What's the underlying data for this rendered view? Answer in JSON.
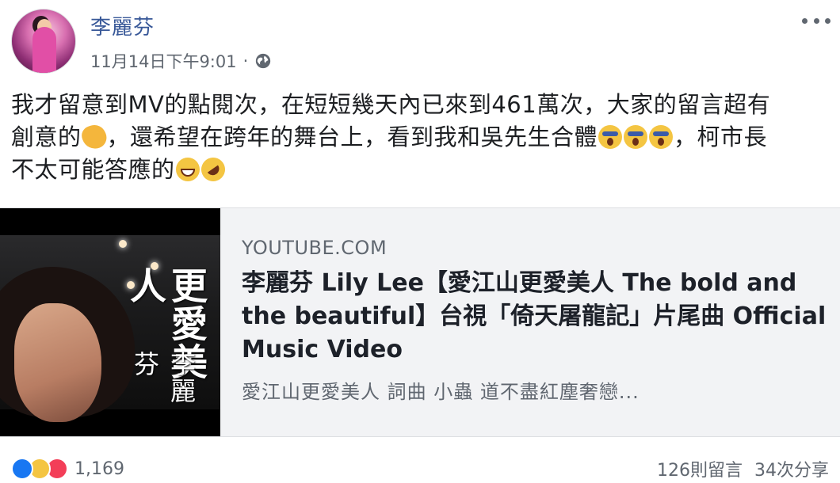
{
  "post": {
    "author": "李麗芬",
    "timestamp": "11月14日下午9:01",
    "separator": "·",
    "privacy_icon": "globe-icon",
    "more_icon": "more-options-icon",
    "text_line1": "我才留意到MV的點閱次，在短短幾天內已來到461萬次，大家的留言超有",
    "text_line2a": "創意的",
    "text_line2b": "，還希望在跨年的舞台上，看到我和吳先生合體",
    "text_line2c": "，柯市長",
    "text_line3": "不太可能答應的"
  },
  "link_card": {
    "domain": "YOUTUBE.COM",
    "title": "李麗芬 Lily Lee【愛江山更愛美人 The bold and the beautiful】台視「倚天屠龍記」片尾曲 Official Music Video",
    "description": "愛江山更愛美人 詞曲 小蟲 道不盡紅塵奢戀...",
    "thumb_title": "更愛美人",
    "thumb_name": "李麗芬"
  },
  "footer": {
    "reaction_count": "1,169",
    "comments": "126則留言",
    "shares": "34次分享"
  }
}
